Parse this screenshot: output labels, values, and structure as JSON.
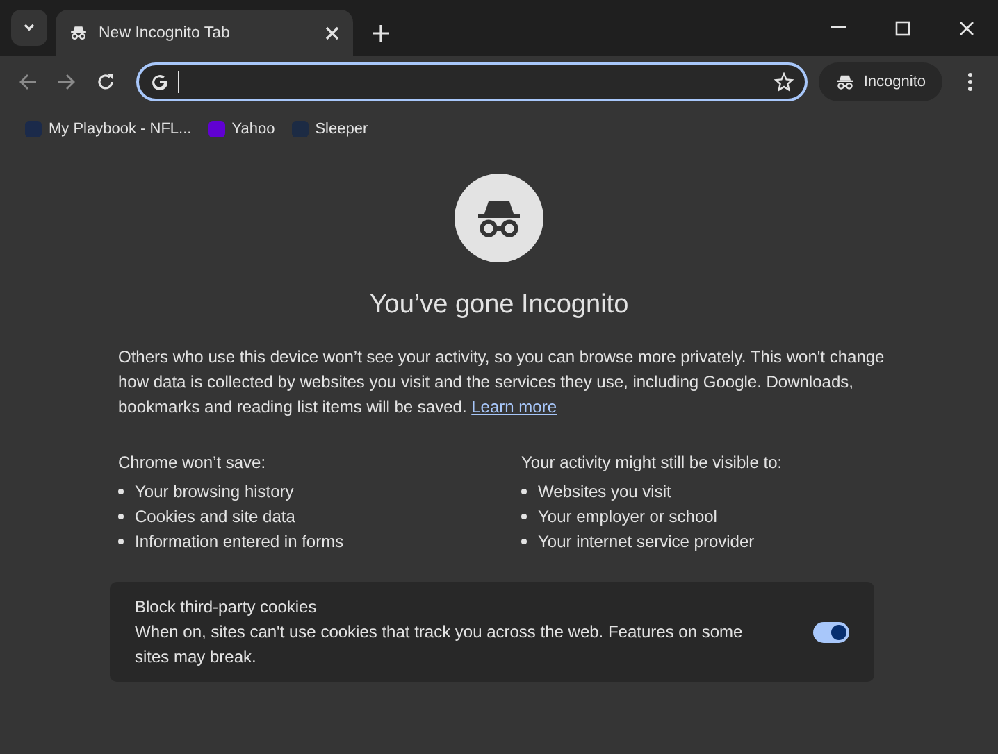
{
  "tab": {
    "title": "New Incognito Tab",
    "selected": true
  },
  "profile_button": {
    "label": "Incognito"
  },
  "bookmarks": [
    {
      "label": "My Playbook - NFL...",
      "color": "#1b2a4a"
    },
    {
      "label": "Yahoo",
      "color": "#6001d2"
    },
    {
      "label": "Sleeper",
      "color": "#1c2b44"
    }
  ],
  "heading": "You’ve gone Incognito",
  "intro": "Others who use this device won’t see your activity, so you can browse more privately. This won't change how data is collected by websites you visit and the services they use, including Google. Downloads, bookmarks and reading list items will be saved.",
  "learn_more": "Learn more",
  "columns": [
    {
      "title": "Chrome won’t save:",
      "items": [
        "Your browsing history",
        "Cookies and site data",
        "Information entered in forms"
      ]
    },
    {
      "title": "Your activity might still be visible to:",
      "items": [
        "Websites you visit",
        "Your employer or school",
        "Your internet service provider"
      ]
    }
  ],
  "cookie_card": {
    "title": "Block third-party cookies",
    "description": "When on, sites can't use cookies that track you across the web. Features on some sites may break.",
    "on": true
  }
}
